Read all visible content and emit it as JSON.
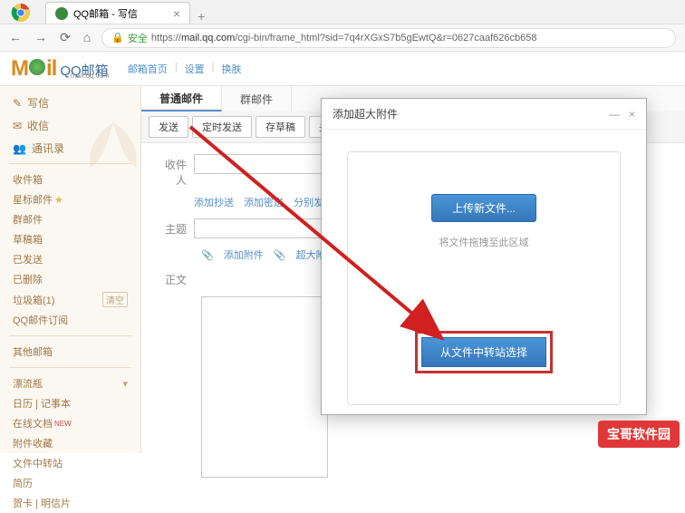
{
  "browser": {
    "tab_title": "QQ邮箱 - 写信",
    "secure_label": "安全",
    "url_prefix": "https://",
    "url_domain": "mail.qq.com",
    "url_path": "/cgi-bin/frame_html?sid=7q4rXGxS7b5gEwtQ&r=0627caaf626cb658"
  },
  "logo": {
    "text": "Mail",
    "brand": "QQ邮箱",
    "sub": "mail.qq.com"
  },
  "header_nav": {
    "home": "邮箱首页",
    "settings": "设置",
    "skin": "换肤"
  },
  "sidebar": {
    "primary": [
      {
        "icon": "compose",
        "label": "写信"
      },
      {
        "icon": "inbox",
        "label": "收信"
      },
      {
        "icon": "contacts",
        "label": "通讯录"
      }
    ],
    "folders": [
      {
        "label": "收件箱"
      },
      {
        "label": "星标邮件",
        "star": true
      },
      {
        "label": "群邮件"
      },
      {
        "label": "草稿箱"
      },
      {
        "label": "已发送"
      },
      {
        "label": "已删除"
      },
      {
        "label": "垃圾箱(1)",
        "empty_btn": "清空"
      },
      {
        "label": "QQ邮件订阅"
      }
    ],
    "other_label": "其他邮箱",
    "extras": [
      {
        "label": "漂流瓶",
        "arrow": true
      },
      {
        "label": "日历 | 记事本"
      },
      {
        "label": "在线文档",
        "new": "NEW"
      },
      {
        "label": "附件收藏"
      },
      {
        "label": "文件中转站"
      },
      {
        "label": "简历"
      },
      {
        "label": "贺卡 | 明信片"
      }
    ]
  },
  "compose": {
    "tabs": {
      "normal": "普通邮件",
      "group": "群邮件"
    },
    "actions": {
      "send": "发送",
      "timed": "定时发送",
      "draft": "存草稿",
      "close": "关闭"
    },
    "recipient_label": "收件人",
    "links": {
      "cc": "添加抄送",
      "bcc": "添加密送",
      "separate": "分别发送"
    },
    "subject_label": "主题",
    "attach": {
      "add": "添加附件",
      "big": "超大附件"
    },
    "body_label": "正文"
  },
  "modal": {
    "title": "添加超大附件",
    "upload_btn": "上传新文件...",
    "hint": "将文件拖拽至此区域",
    "transfer_btn": "从文件中转站选择"
  },
  "watermark": "宝哥软件园"
}
